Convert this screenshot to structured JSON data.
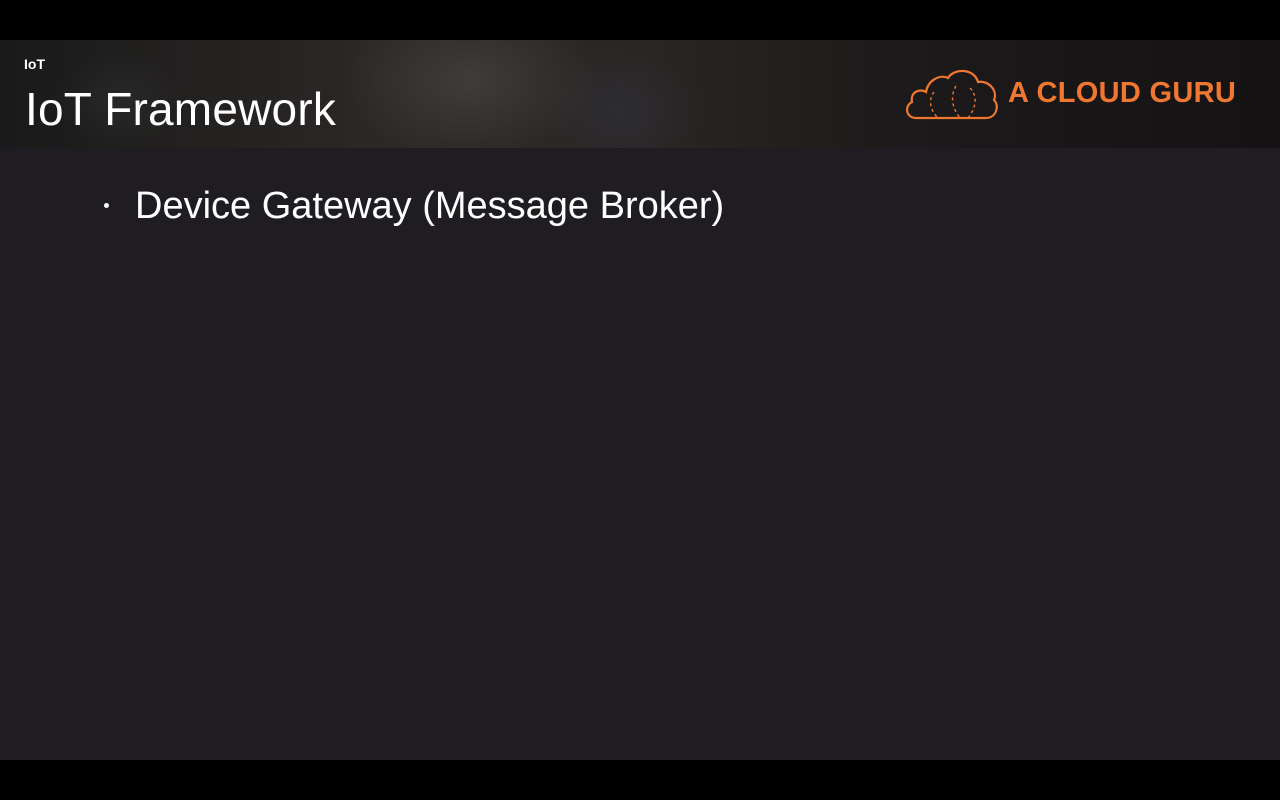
{
  "slide": {
    "kicker": "IoT",
    "title": "IoT Framework",
    "logo": {
      "text": "A CLOUD GURU",
      "icon": "cloud-icon",
      "color": "#f0772f"
    },
    "bullets": [
      {
        "text": "Device Gateway (Message Broker)"
      }
    ]
  },
  "colors": {
    "background": "#1f1d21",
    "letterbox": "#000000",
    "text": "#ffffff",
    "accent": "#f0772f"
  }
}
